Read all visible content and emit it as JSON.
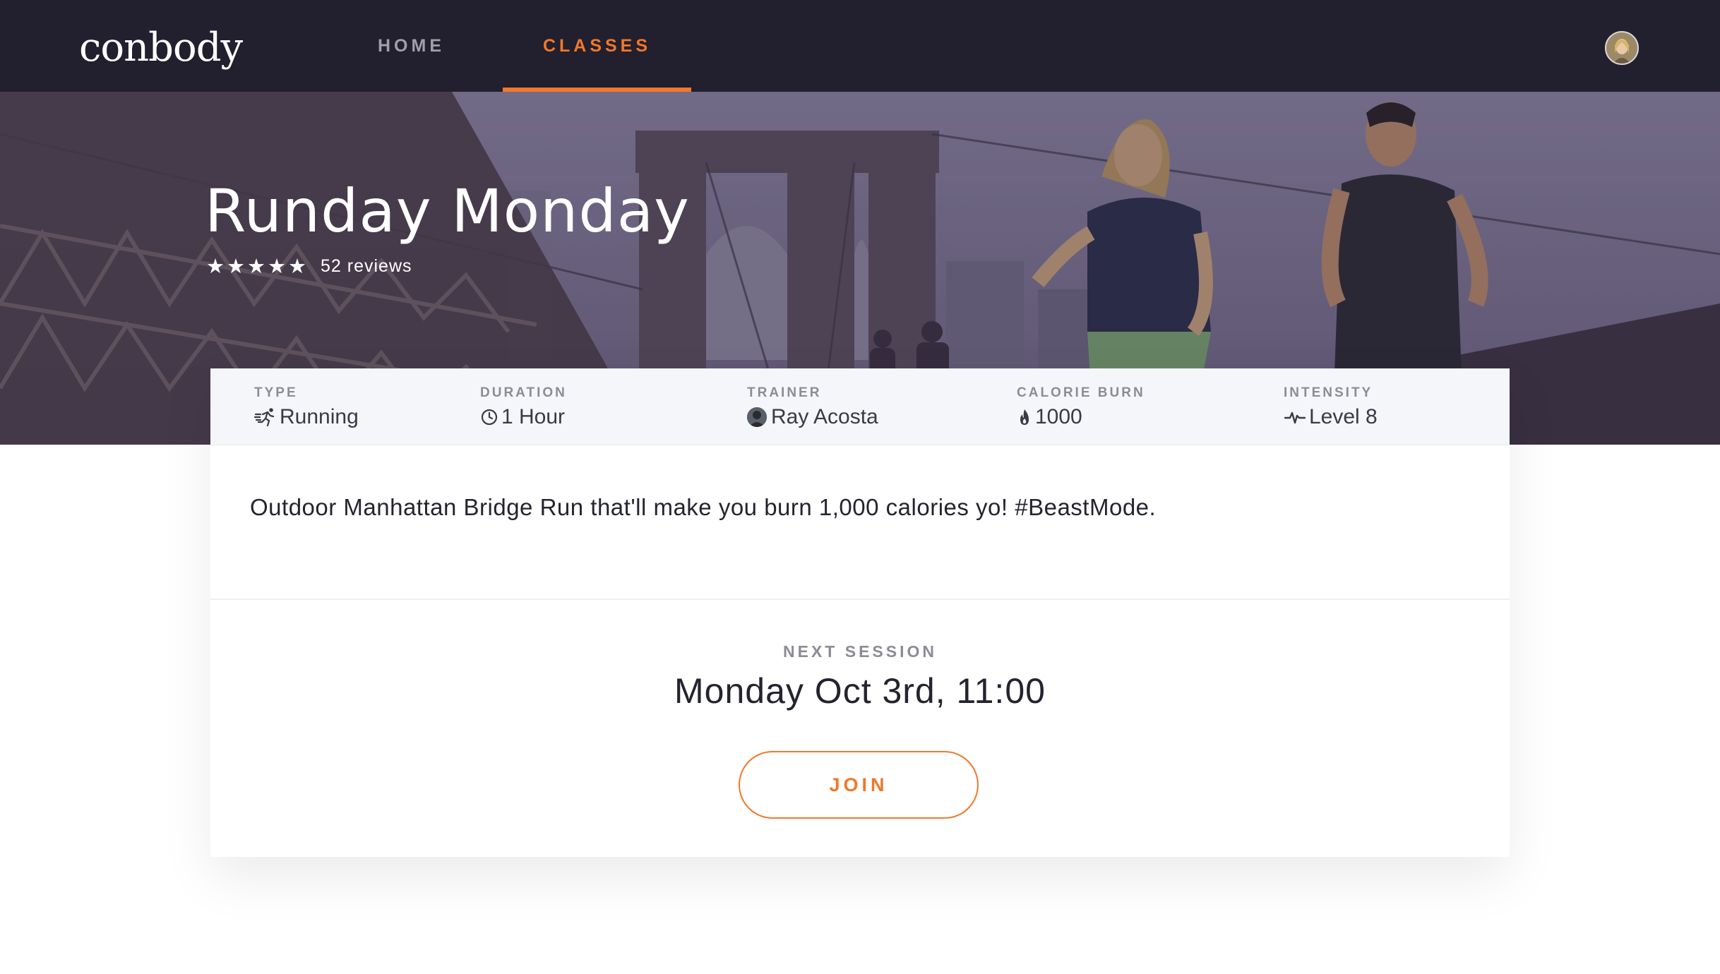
{
  "nav": {
    "logo_text": "conbody",
    "links": [
      {
        "label": "HOME",
        "active": false
      },
      {
        "label": "CLASSES",
        "active": true
      }
    ],
    "accent_color": "#f0782a",
    "background_color": "#221f2e"
  },
  "hero": {
    "title": "Runday Monday",
    "rating_stars": 5,
    "reviews": "52 reviews"
  },
  "meta": {
    "type": {
      "label": "TYPE",
      "value": "Running",
      "icon": "runner-icon"
    },
    "duration": {
      "label": "DURATION",
      "value": "1 Hour",
      "icon": "clock-icon"
    },
    "trainer": {
      "label": "TRAINER",
      "value": "Ray Acosta",
      "icon": "trainer-avatar"
    },
    "calories": {
      "label": "CALORIE BURN",
      "value": "1000",
      "icon": "flame-icon"
    },
    "intensity": {
      "label": "INTENSITY",
      "value": "Level 8",
      "icon": "pulse-icon"
    }
  },
  "description": "Outdoor Manhattan Bridge Run that'll make you burn 1,000 calories yo! #BeastMode.",
  "session": {
    "label": "NEXT SESSION",
    "date": "Monday Oct 3rd, 11:00",
    "join_label": "JOIN"
  }
}
